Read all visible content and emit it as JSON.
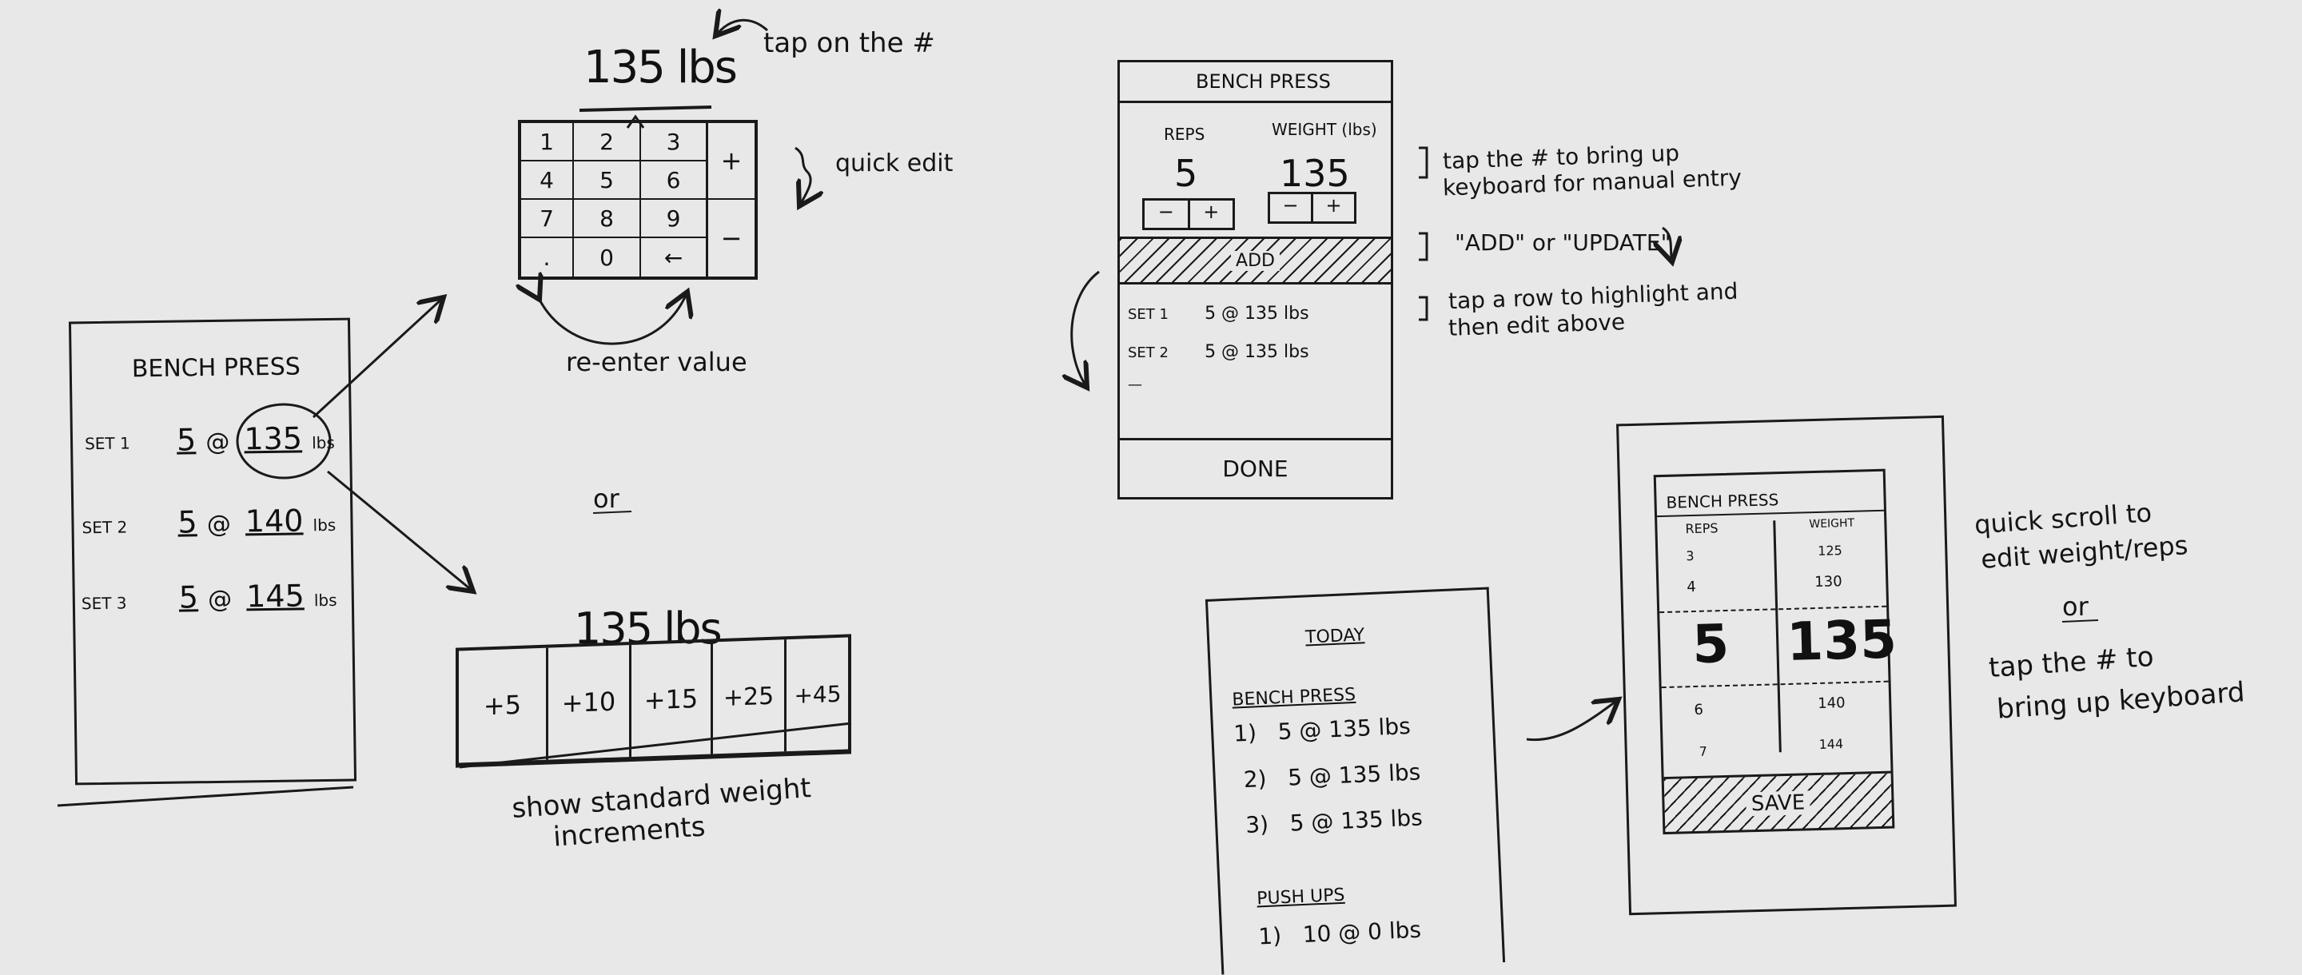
{
  "sketch1": {
    "title": "BENCH PRESS",
    "sets": [
      {
        "label": "SET 1",
        "reps": "5",
        "at": "@",
        "weight": "135",
        "unit": "lbs"
      },
      {
        "label": "SET 2",
        "reps": "5",
        "at": "@",
        "weight": "140",
        "unit": "lbs"
      },
      {
        "label": "SET 3",
        "reps": "5",
        "at": "@",
        "weight": "145",
        "unit": "lbs"
      }
    ]
  },
  "keypad": {
    "value": "135 lbs",
    "note_tap": "tap on the #",
    "note_quick": "quick edit",
    "keys": [
      "1",
      "2",
      "3",
      "4",
      "5",
      "6",
      "7",
      "8",
      "9",
      ".",
      "0",
      "←"
    ],
    "plus": "+",
    "minus": "−",
    "caption": "re-enter value"
  },
  "or1": "or",
  "increments": {
    "value": "135 lbs",
    "buttons": [
      "+5",
      "+10",
      "+15",
      "+25",
      "+45"
    ],
    "caption_line1": "show standard weight",
    "caption_line2": "increments"
  },
  "sketch2": {
    "title": "BENCH PRESS",
    "reps_label": "REPS",
    "weight_label": "WEIGHT (lbs)",
    "reps_value": "5",
    "weight_value": "135",
    "minus": "−",
    "plus": "+",
    "add_label": "ADD",
    "rows": [
      {
        "label": "SET 1",
        "value": "5  @  135 lbs"
      },
      {
        "label": "SET 2",
        "value": "5  @  135 lbs"
      }
    ],
    "dash": "—",
    "done_label": "DONE",
    "note1_line1": "tap the # to bring up",
    "note1_line2": "keyboard for manual entry",
    "note2": "\"ADD\" or \"UPDATE\"",
    "note3_line1": "tap a row to highlight and",
    "note3_line2": "then edit above"
  },
  "sketch3": {
    "title": "TODAY",
    "section1": "BENCH PRESS",
    "items1": [
      "1)   5 @ 135 lbs",
      "2)   5 @ 135 lbs",
      "3)   5 @ 135 lbs"
    ],
    "section2": "PUSH UPS",
    "items2": [
      "1)   10 @ 0 lbs"
    ]
  },
  "sketch4": {
    "title": "BENCH PRESS",
    "reps_label": "REPS",
    "weight_label": "WEIGHT",
    "rows_above": [
      [
        "3",
        "125"
      ],
      [
        "4",
        "130"
      ]
    ],
    "selected": [
      "5",
      "135"
    ],
    "rows_below": [
      [
        "6",
        "140"
      ],
      [
        "7",
        "144"
      ]
    ],
    "save_label": "SAVE",
    "note_line1": "quick scroll to",
    "note_line2": "edit weight/reps",
    "note_or": "or",
    "note_line3": "tap the # to",
    "note_line4": "bring up keyboard"
  }
}
